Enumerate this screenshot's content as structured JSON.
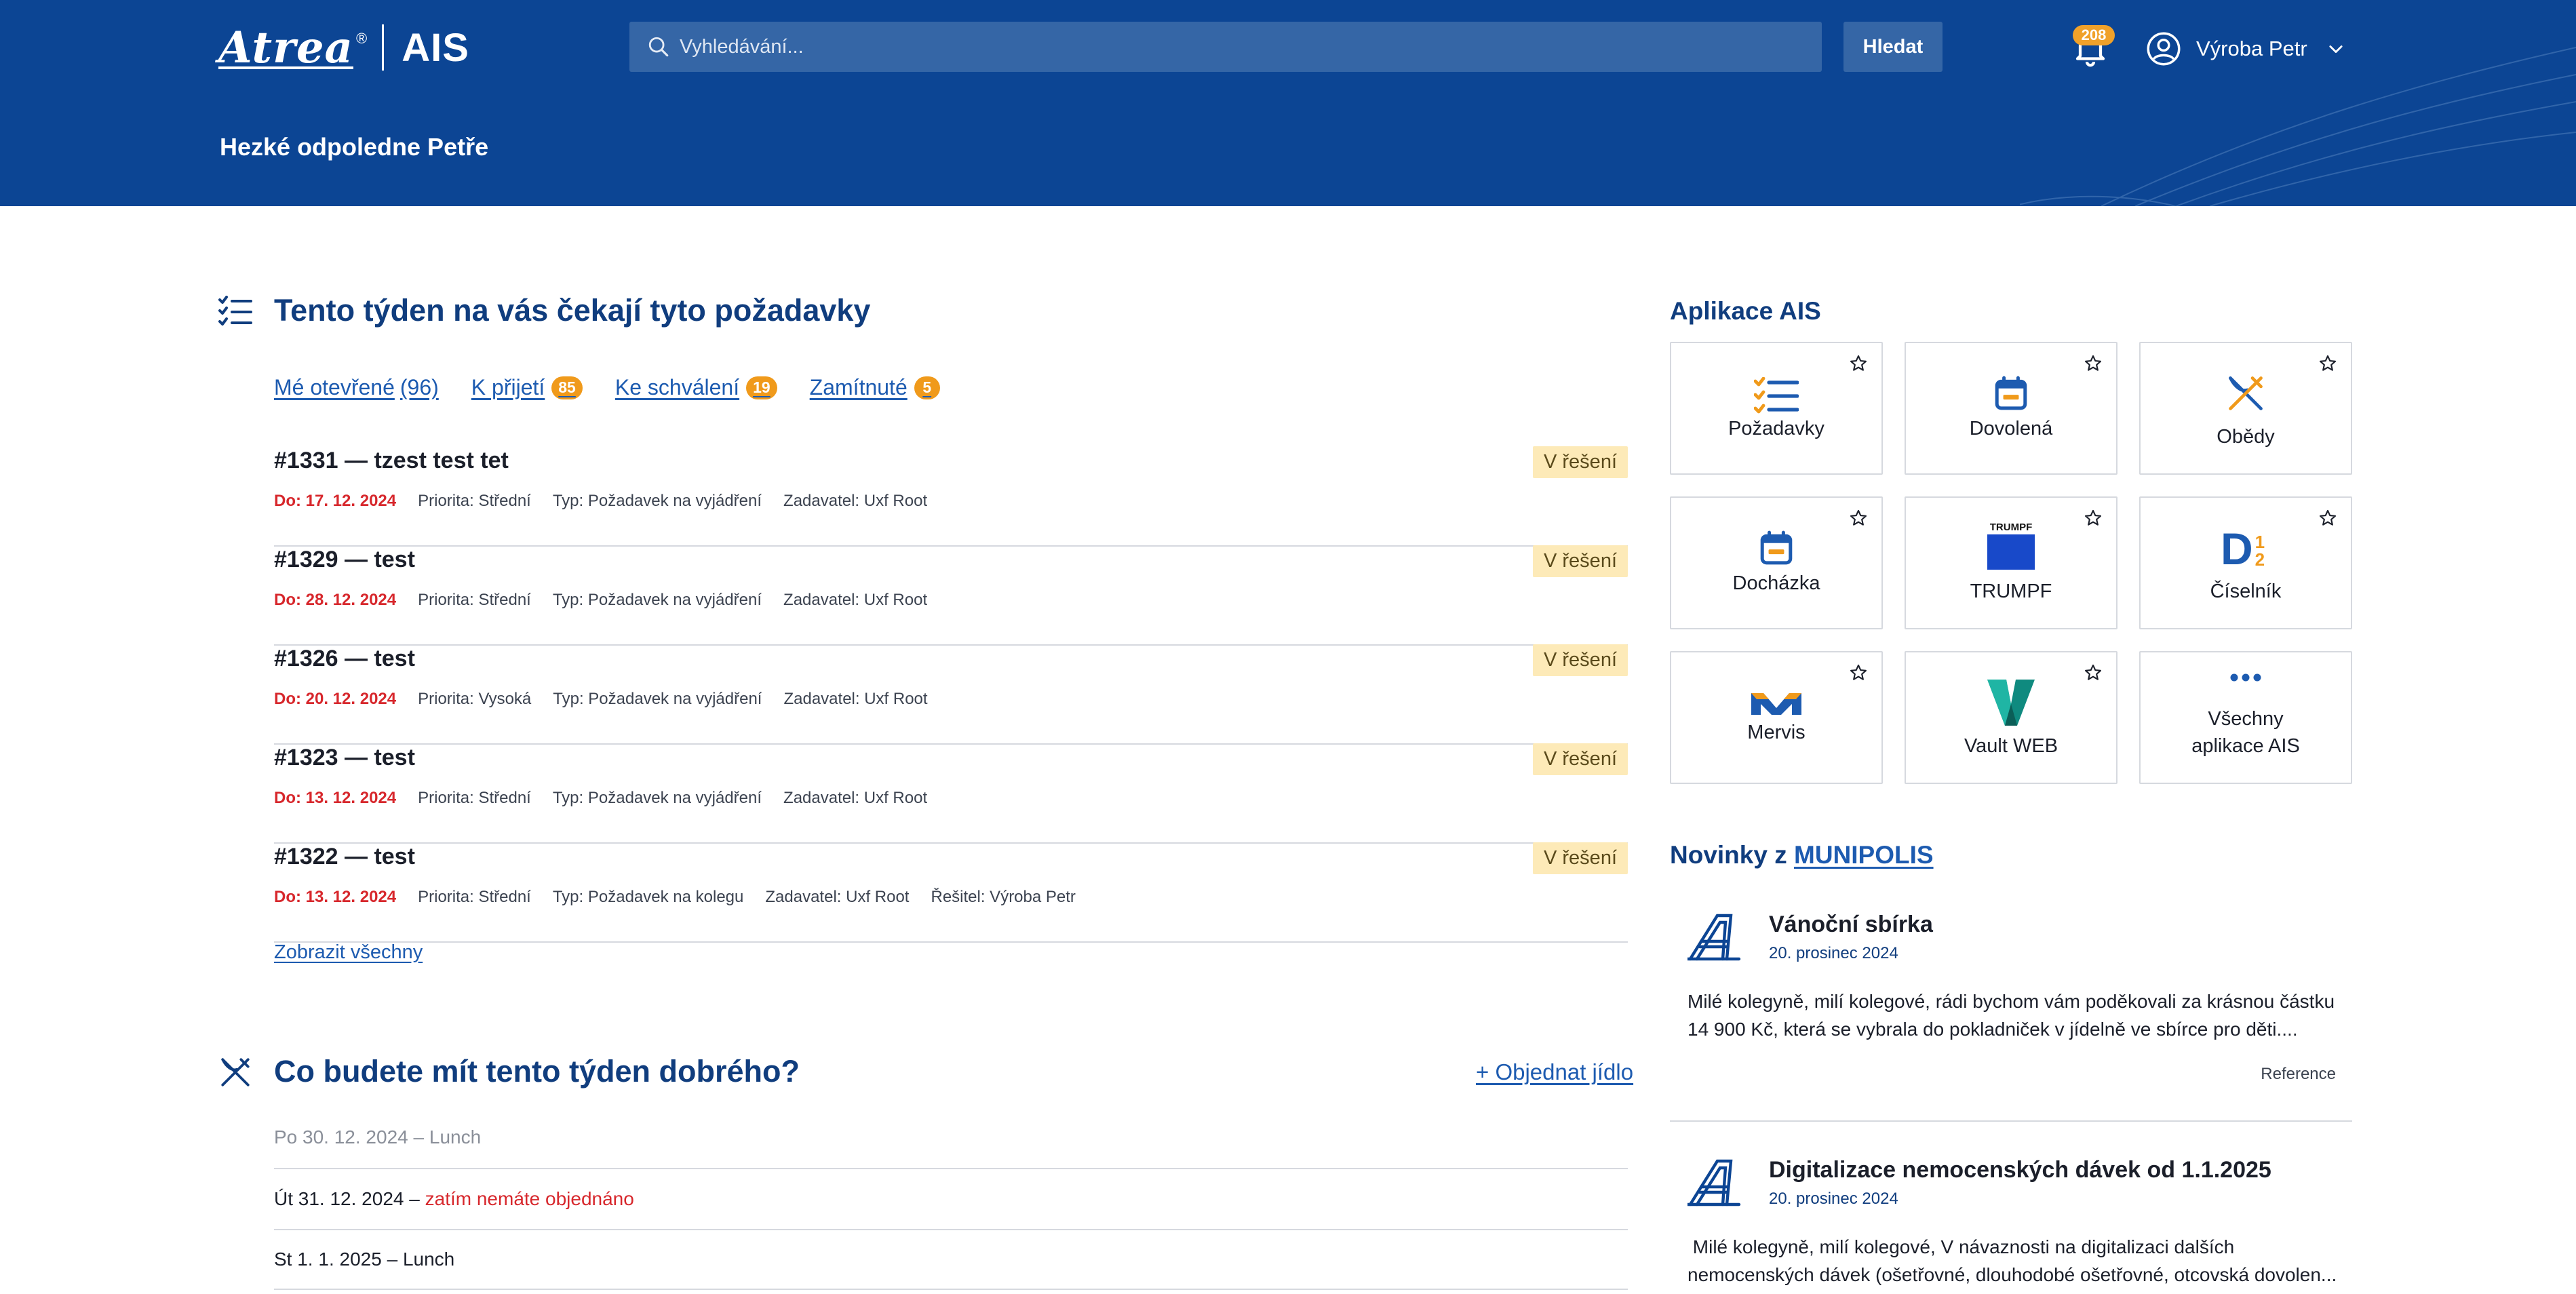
{
  "header": {
    "logo_brand": "Atrea",
    "logo_reg": "®",
    "logo_app": "AIS",
    "search_placeholder": "Vyhledávání...",
    "search_button": "Hledat",
    "notifications_count": "208",
    "user_name": "Výroba Petr",
    "greeting": "Hezké odpoledne Petře"
  },
  "requests": {
    "title": "Tento týden na vás čekají tyto požadavky",
    "tabs": [
      {
        "label": "Mé otevřené",
        "count": "(96)"
      },
      {
        "label": "K přijetí",
        "badge": "85"
      },
      {
        "label": "Ke schválení",
        "badge": "19"
      },
      {
        "label": "Zamítnuté",
        "badge": "5"
      }
    ],
    "items": [
      {
        "title": "#1331 — tzest test tet",
        "due": "Do: 17. 12. 2024",
        "priority": "Priorita: Střední",
        "type": "Typ: Požadavek na vyjádření",
        "requester": "Zadavatel: Uxf Root",
        "solver": "",
        "status": "V řešení"
      },
      {
        "title": "#1329 — test",
        "due": "Do: 28. 12. 2024",
        "priority": "Priorita: Střední",
        "type": "Typ: Požadavek na vyjádření",
        "requester": "Zadavatel: Uxf Root",
        "solver": "",
        "status": "V řešení"
      },
      {
        "title": "#1326 — test",
        "due": "Do: 20. 12. 2024",
        "priority": "Priorita: Vysoká",
        "type": "Typ: Požadavek na vyjádření",
        "requester": "Zadavatel: Uxf Root",
        "solver": "",
        "status": "V řešení"
      },
      {
        "title": "#1323 — test",
        "due": "Do: 13. 12. 2024",
        "priority": "Priorita: Střední",
        "type": "Typ: Požadavek na vyjádření",
        "requester": "Zadavatel: Uxf Root",
        "solver": "",
        "status": "V řešení"
      },
      {
        "title": "#1322 — test",
        "due": "Do: 13. 12. 2024",
        "priority": "Priorita: Střední",
        "type": "Typ: Požadavek na kolegu",
        "requester": "Zadavatel: Uxf Root",
        "solver": "Řešitel: Výroba Petr",
        "status": "V řešení"
      }
    ],
    "show_all": "Zobrazit všechny"
  },
  "meals": {
    "title": "Co budete mít tento týden dobrého?",
    "order_link": "+ Objednat jídlo",
    "days": [
      {
        "date": "Po 30. 12. 2024",
        "sep": " – ",
        "value": "Lunch",
        "state": "past"
      },
      {
        "date": "Út 31. 12. 2024",
        "sep": " – ",
        "value": "zatím nemáte objednáno",
        "state": "warn"
      },
      {
        "date": "St 1. 1. 2025",
        "sep": " – ",
        "value": "Lunch",
        "state": "normal"
      }
    ]
  },
  "apps": {
    "title": "Aplikace AIS",
    "items": [
      {
        "label": "Požadavky",
        "icon": "checklist-icon",
        "favorite": true
      },
      {
        "label": "Dovolená",
        "icon": "calendar-icon",
        "favorite": true
      },
      {
        "label": "Obědy",
        "icon": "fork-knife-icon",
        "favorite": true
      },
      {
        "label": "Docházka",
        "icon": "calendar-icon",
        "favorite": true
      },
      {
        "label": "TRUMPF",
        "icon": "trumpf-logo",
        "logo_text": "TRUMPF",
        "favorite": true
      },
      {
        "label": "Číselník",
        "icon": "dictionary-logo",
        "logo_text": "D",
        "logo_sup": "1",
        "logo_sub": "2",
        "favorite": true
      },
      {
        "label": "Mervis",
        "icon": "mervis-logo",
        "favorite": true
      },
      {
        "label": "Vault WEB",
        "icon": "vault-logo",
        "favorite": true
      },
      {
        "label_line1": "Všechny",
        "label_line2": "aplikace AIS",
        "icon": "more-dots-icon",
        "favorite": false
      }
    ]
  },
  "news": {
    "title_prefix": "Novinky z ",
    "title_link": "MUNIPOLIS",
    "items": [
      {
        "title": "Vánoční sbírka",
        "date": "20. prosinec 2024",
        "text": "Milé kolegyně, milí kolegové, rádi bychom vám poděkovali za krásnou částku 14 900 Kč, která se vybrala do pokladniček v jídelně ve sbírce pro děti....",
        "ref": "Reference"
      },
      {
        "title": "Digitalizace nemocenských dávek od 1.1.2025",
        "date": "20. prosinec 2024",
        "text": " Milé kolegyně, milí kolegové, V návaznosti na digitalizaci dalších nemocenských dávek (ošetřovné, dlouhodobé ošetřovné, otcovská dovolen..."
      }
    ]
  },
  "colors": {
    "header_bg": "#0c4594",
    "accent": "#1d5bb0",
    "badge": "#f09a1b",
    "status_bg": "#fdeab8",
    "due": "#d7272c"
  }
}
